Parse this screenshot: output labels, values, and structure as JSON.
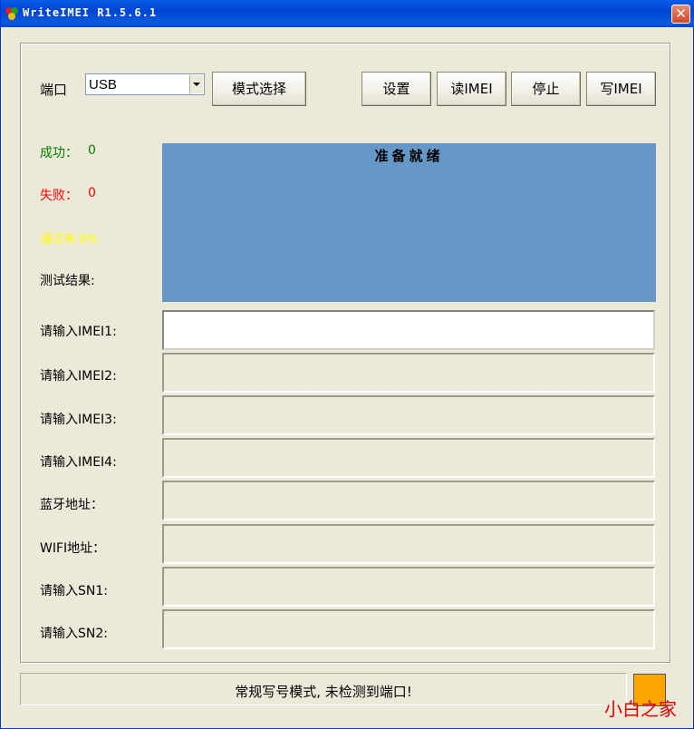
{
  "window": {
    "title": "WriteIMEI R1.5.6.1",
    "close_label": "✕"
  },
  "toolbar": {
    "port_label": "端口",
    "port_value": "USB",
    "mode_button": "模式选择",
    "settings_button": "设置",
    "read_imei_button": "读IMEI",
    "stop_button": "停止",
    "write_imei_button": "写IMEI"
  },
  "stats": {
    "success_label": "成功：",
    "success_value": "0",
    "fail_label": "失败：",
    "fail_value": "0",
    "pass_rate": "通过率:0%",
    "result_label": "测试结果:"
  },
  "status_panel": {
    "text": "准备就绪"
  },
  "fields": [
    {
      "label": "请输入IMEI1:",
      "value": ""
    },
    {
      "label": "请输入IMEI2:",
      "value": ""
    },
    {
      "label": "请输入IMEI3:",
      "value": ""
    },
    {
      "label": "请输入IMEI4:",
      "value": ""
    },
    {
      "label": "蓝牙地址：",
      "value": ""
    },
    {
      "label": "WIFI地址：",
      "value": ""
    },
    {
      "label": "请输入SN1:",
      "value": ""
    },
    {
      "label": "请输入SN2:",
      "value": ""
    }
  ],
  "statusbar": {
    "text": "常规写号模式, 未检测到端口!"
  },
  "watermark": "小白之家",
  "colors": {
    "success": "#008000",
    "fail": "#ff0000",
    "pass_rate": "#ffff00",
    "status_panel": "#6598c7",
    "indicator": "#ffa500"
  }
}
